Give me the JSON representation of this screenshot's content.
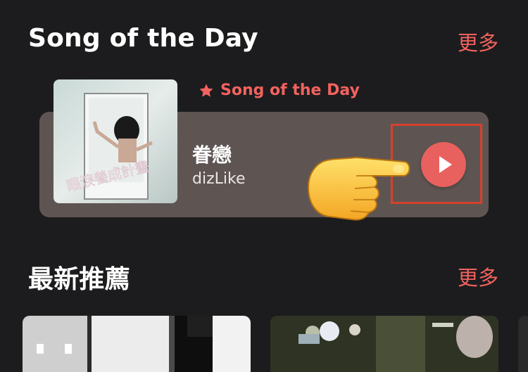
{
  "sections": {
    "song_of_day": {
      "title": "Song of the Day",
      "more_label": "更多"
    },
    "new_recommend": {
      "title": "最新推薦",
      "more_label": "更多"
    }
  },
  "card": {
    "badge_label": "Song of the Day",
    "song_title": "眷戀",
    "artist": "dizLike",
    "cover_text": "眼淚養成計畫"
  },
  "colors": {
    "accent": "#f2625f",
    "card_bg": "#5e5553",
    "highlight": "#d7402c",
    "background": "#1c1c1e"
  },
  "icons": {
    "badge": "star-icon",
    "play": "play-icon",
    "pointer": "pointing-hand-icon"
  }
}
